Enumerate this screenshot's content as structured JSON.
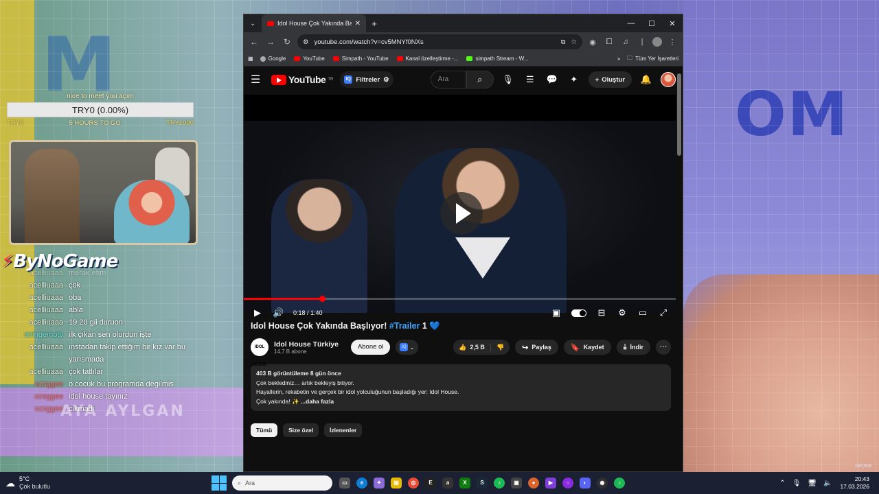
{
  "goal": {
    "title": "nice to meet you açım",
    "bar_text": "TRY0 (0.00%)",
    "progress": 0.0,
    "left": "TRY0",
    "mid": "5 HOURS TO GO",
    "right": "TRY1000"
  },
  "stream": {
    "logo": "ByNoGame",
    "overlay_name": "AYA AYLGAN",
    "watermark": "ABONE"
  },
  "chat": [
    {
      "user": "acelliuaaa",
      "msg": "merak etim",
      "style": "faded"
    },
    {
      "user": "acelliuaaa",
      "msg": "çok",
      "style": ""
    },
    {
      "user": "acelliuaaa",
      "msg": "oba",
      "style": ""
    },
    {
      "user": "acelliuaaa",
      "msg": "abla",
      "style": ""
    },
    {
      "user": "acelliuaaa",
      "msg": "19 20 gii duruon",
      "style": ""
    },
    {
      "user": "stringempty",
      "msg": "ilk çıkan sen olurdun işte",
      "style": "alt"
    },
    {
      "user": "acelliuaaa",
      "msg": "ınstadan takip ettiğim bir kız var bu yarısmada",
      "style": ""
    },
    {
      "user": "acelliuaaa",
      "msg": "çok tatlılar",
      "style": ""
    },
    {
      "user": "ozsggee",
      "msg": "o cocuk bu programda degilmis",
      "style": "red"
    },
    {
      "user": "ozsggee",
      "msg": "idol house tayınız",
      "style": "red"
    },
    {
      "user": "ozsggee",
      "msg": "cikmadi",
      "style": "red"
    }
  ],
  "browser": {
    "tab_title": "Idol House Çok Yakında Başlıyor",
    "url": "youtube.com/watch?v=cv5MNYf0NXs",
    "bookmarks": [
      {
        "label": "Google",
        "icon": "google"
      },
      {
        "label": "YouTube",
        "icon": "youtube"
      },
      {
        "label": "Simpath - YouTube",
        "icon": "youtube"
      },
      {
        "label": "Kanal özelleştirme -...",
        "icon": "youtube"
      },
      {
        "label": "simpath Stream - W...",
        "icon": "kick"
      }
    ],
    "all_bookmarks": "Tüm Yer İşaretleri"
  },
  "youtube": {
    "region": "TR",
    "filters_label": "Filtreler",
    "search_placeholder": "Ara",
    "create_label": "Oluştur",
    "player": {
      "time": "0:18 / 1:40",
      "progress": 0.18
    },
    "video": {
      "title_main": "Idol House Çok Yakında Başlıyor!",
      "title_tag": "#Trailer",
      "title_num": "1",
      "heart": "💙"
    },
    "channel": {
      "name": "Idol House Türkiye",
      "subs": "14,7 B abone",
      "avatar_text": "IDOL HOUSE",
      "subscribe": "Abone ol"
    },
    "actions": {
      "likes": "2,5 B",
      "share": "Paylaş",
      "save": "Kaydet",
      "download": "İndir"
    },
    "description": {
      "stats": "403 B görüntüleme  8 gün önce",
      "line1": "Çok beklediniz… artık bekleyiş bitiyor.",
      "line2": "Hayallerin, rekabetin ve gerçek bir idol yolculuğunun başladığı yer: Idol House.",
      "line3": "Çok yakında! ✨",
      "more": "...daha fazla"
    },
    "chips": [
      "Tümü",
      "Size özel",
      "İzlenenler"
    ]
  },
  "taskbar": {
    "temp": "5°C",
    "condition": "Çok bulutlu",
    "search": "Ara",
    "time": "20:43",
    "date": "17.03.2026"
  }
}
